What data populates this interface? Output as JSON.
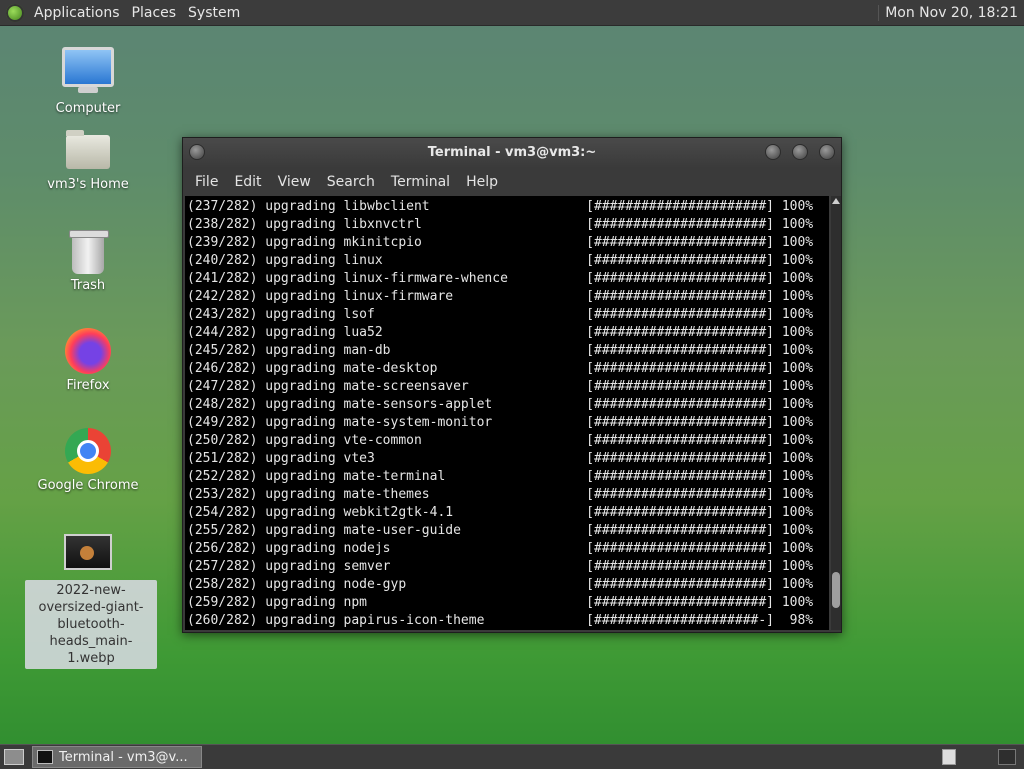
{
  "top_panel": {
    "menus": [
      "Applications",
      "Places",
      "System"
    ],
    "clock": "Mon Nov 20, 18:21"
  },
  "desktop_icons": [
    {
      "label": "Computer",
      "icon": "computer-icon"
    },
    {
      "label": "vm3's Home",
      "icon": "home-folder-icon"
    },
    {
      "label": "Trash",
      "icon": "trash-icon"
    },
    {
      "label": "Firefox",
      "icon": "firefox-icon"
    },
    {
      "label": "Google Chrome",
      "icon": "chrome-icon"
    },
    {
      "label": "2022-new-oversized-giant-bluetooth-heads_main-1.webp",
      "icon": "image-file-icon"
    }
  ],
  "terminal": {
    "title": "Terminal - vm3@vm3:~",
    "menu": [
      "File",
      "Edit",
      "View",
      "Search",
      "Terminal",
      "Help"
    ],
    "lines": [
      {
        "idx": "(237/282)",
        "pkg": "libwbclient",
        "bar": "[######################]",
        "pct": "100%"
      },
      {
        "idx": "(238/282)",
        "pkg": "libxnvctrl",
        "bar": "[######################]",
        "pct": "100%"
      },
      {
        "idx": "(239/282)",
        "pkg": "mkinitcpio",
        "bar": "[######################]",
        "pct": "100%"
      },
      {
        "idx": "(240/282)",
        "pkg": "linux",
        "bar": "[######################]",
        "pct": "100%"
      },
      {
        "idx": "(241/282)",
        "pkg": "linux-firmware-whence",
        "bar": "[######################]",
        "pct": "100%"
      },
      {
        "idx": "(242/282)",
        "pkg": "linux-firmware",
        "bar": "[######################]",
        "pct": "100%"
      },
      {
        "idx": "(243/282)",
        "pkg": "lsof",
        "bar": "[######################]",
        "pct": "100%"
      },
      {
        "idx": "(244/282)",
        "pkg": "lua52",
        "bar": "[######################]",
        "pct": "100%"
      },
      {
        "idx": "(245/282)",
        "pkg": "man-db",
        "bar": "[######################]",
        "pct": "100%"
      },
      {
        "idx": "(246/282)",
        "pkg": "mate-desktop",
        "bar": "[######################]",
        "pct": "100%"
      },
      {
        "idx": "(247/282)",
        "pkg": "mate-screensaver",
        "bar": "[######################]",
        "pct": "100%"
      },
      {
        "idx": "(248/282)",
        "pkg": "mate-sensors-applet",
        "bar": "[######################]",
        "pct": "100%"
      },
      {
        "idx": "(249/282)",
        "pkg": "mate-system-monitor",
        "bar": "[######################]",
        "pct": "100%"
      },
      {
        "idx": "(250/282)",
        "pkg": "vte-common",
        "bar": "[######################]",
        "pct": "100%"
      },
      {
        "idx": "(251/282)",
        "pkg": "vte3",
        "bar": "[######################]",
        "pct": "100%"
      },
      {
        "idx": "(252/282)",
        "pkg": "mate-terminal",
        "bar": "[######################]",
        "pct": "100%"
      },
      {
        "idx": "(253/282)",
        "pkg": "mate-themes",
        "bar": "[######################]",
        "pct": "100%"
      },
      {
        "idx": "(254/282)",
        "pkg": "webkit2gtk-4.1",
        "bar": "[######################]",
        "pct": "100%"
      },
      {
        "idx": "(255/282)",
        "pkg": "mate-user-guide",
        "bar": "[######################]",
        "pct": "100%"
      },
      {
        "idx": "(256/282)",
        "pkg": "nodejs",
        "bar": "[######################]",
        "pct": "100%"
      },
      {
        "idx": "(257/282)",
        "pkg": "semver",
        "bar": "[######################]",
        "pct": "100%"
      },
      {
        "idx": "(258/282)",
        "pkg": "node-gyp",
        "bar": "[######################]",
        "pct": "100%"
      },
      {
        "idx": "(259/282)",
        "pkg": "npm",
        "bar": "[######################]",
        "pct": "100%"
      },
      {
        "idx": "(260/282)",
        "pkg": "papirus-icon-theme",
        "bar": "[#####################-]",
        "pct": " 98%"
      }
    ]
  },
  "taskbar": {
    "task_label": "Terminal - vm3@v..."
  }
}
